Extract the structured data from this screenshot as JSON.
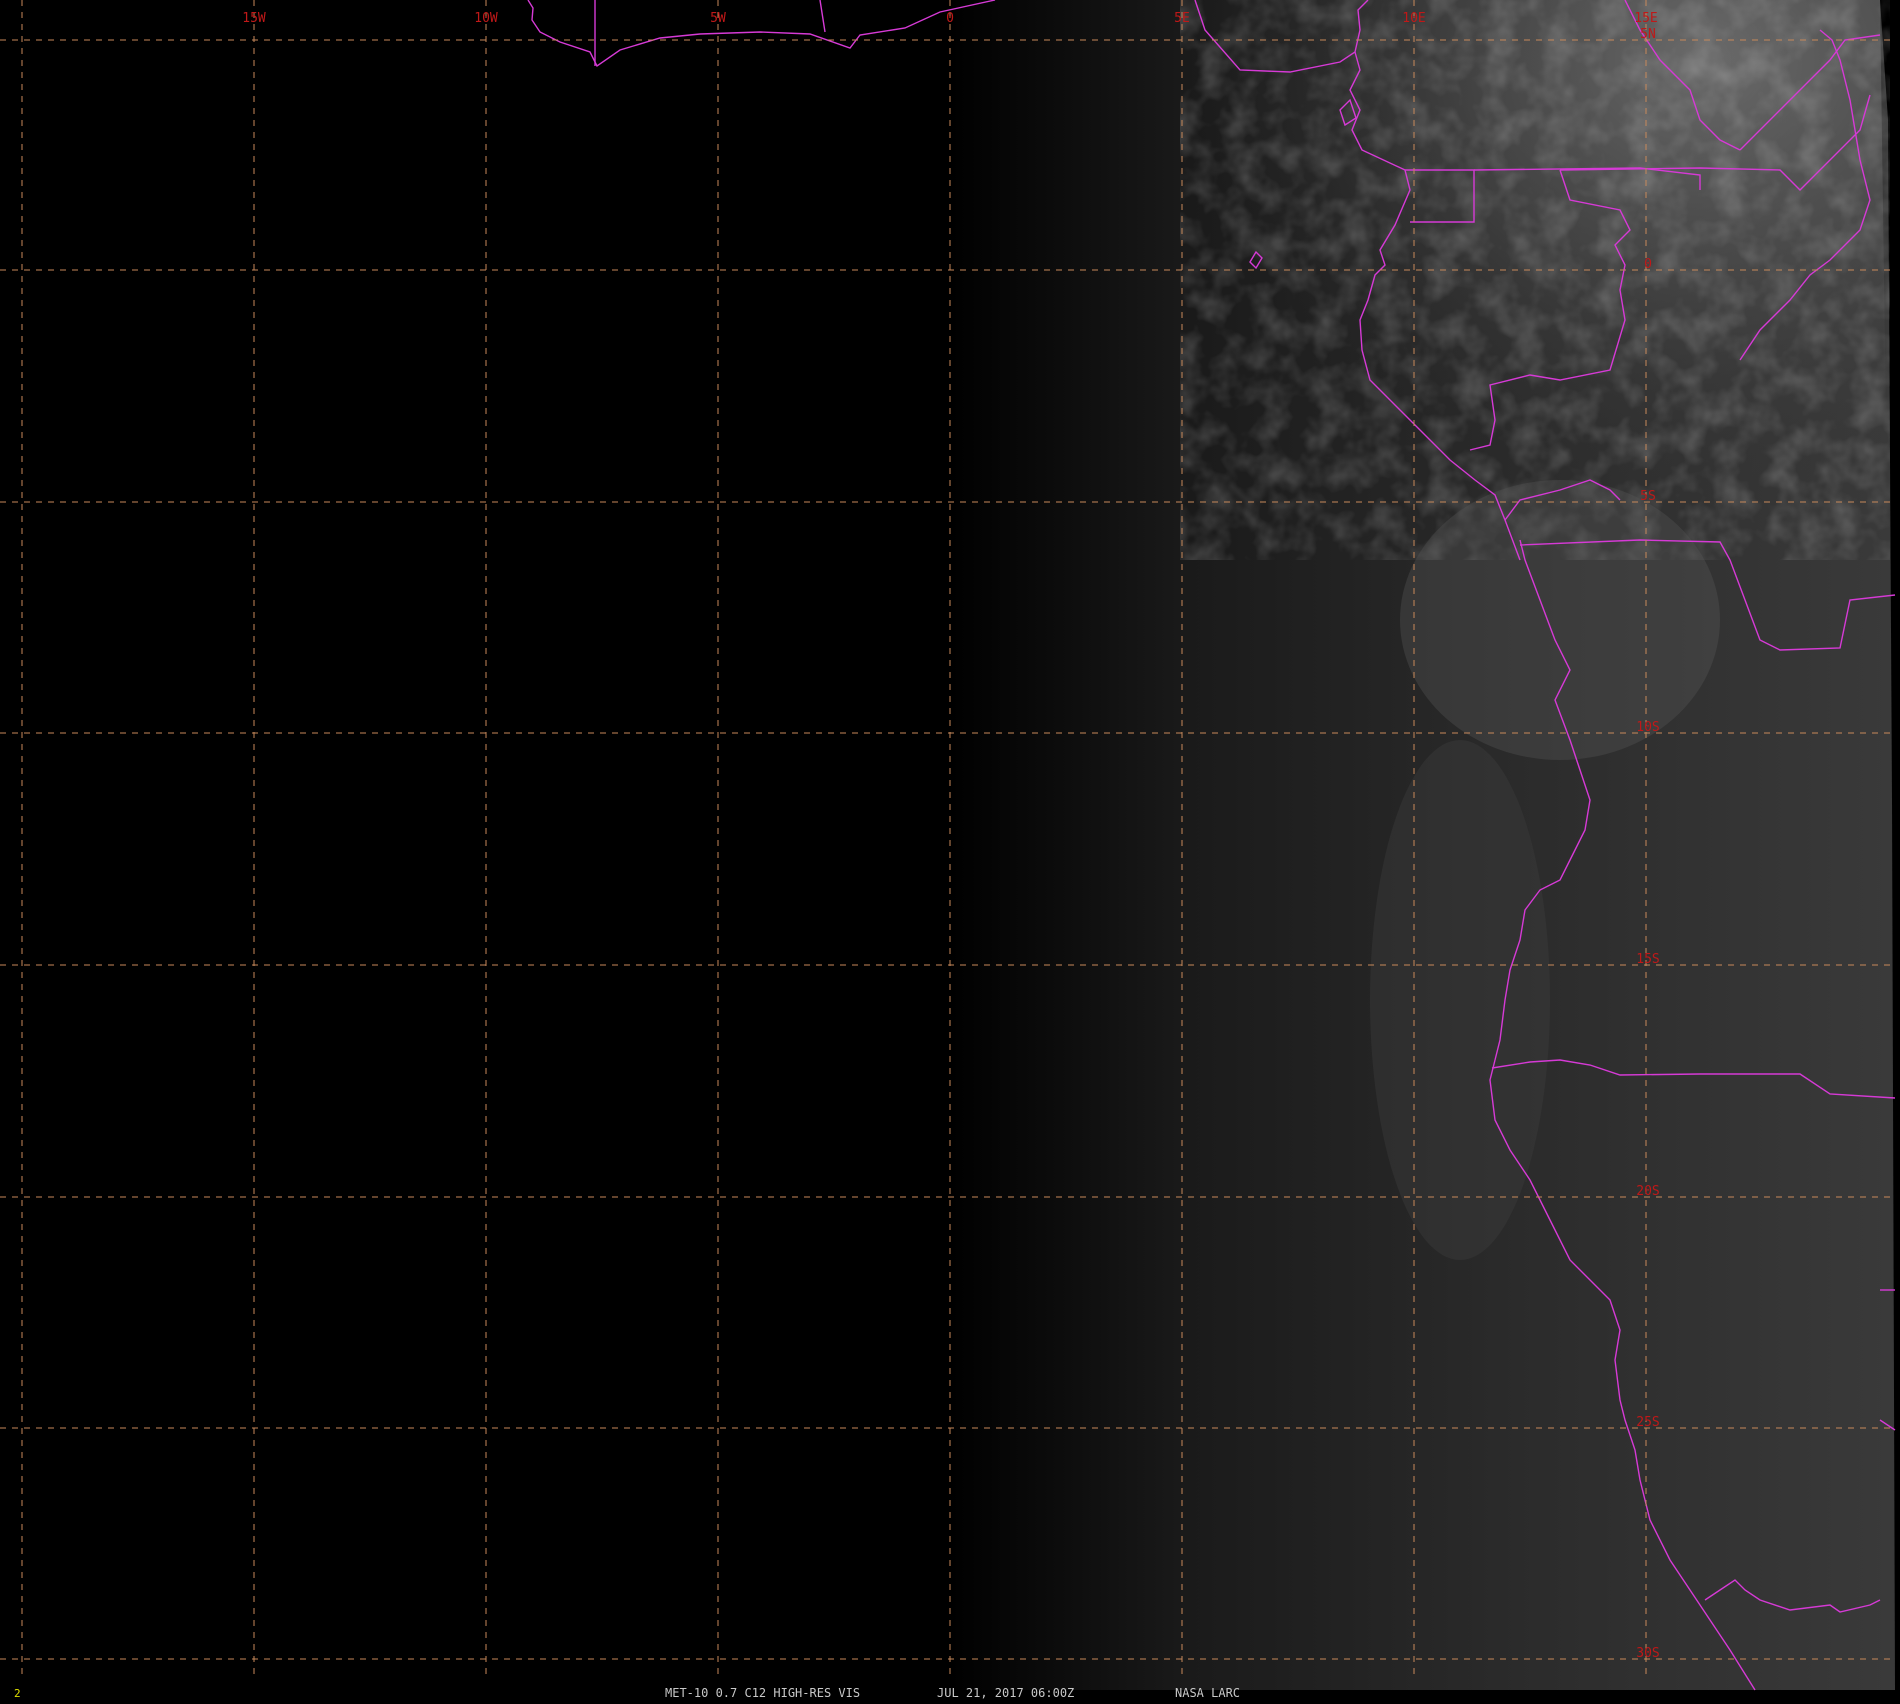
{
  "colors": {
    "background": "#000000",
    "graticule": "#c8895a",
    "coastline": "#d63ad6",
    "lat_lon_label": "#c01818",
    "footer_text": "#c8c8c8",
    "frame_number": "#e0e000",
    "cloud_grey": "#8a8a8a"
  },
  "graticule": {
    "longitude_labels": [
      "15W",
      "10W",
      "5W",
      "0",
      "5E",
      "10E",
      "15E"
    ],
    "latitude_labels": [
      "5N",
      "0",
      "5S",
      "10S",
      "15S",
      "20S",
      "25S",
      "30S"
    ]
  },
  "footer": {
    "frame_number": "2",
    "title": "MET-10 0.7 C12 HIGH-RES VIS",
    "datetime": "JUL 21, 2017 06:00Z",
    "source": "NASA LARC"
  }
}
